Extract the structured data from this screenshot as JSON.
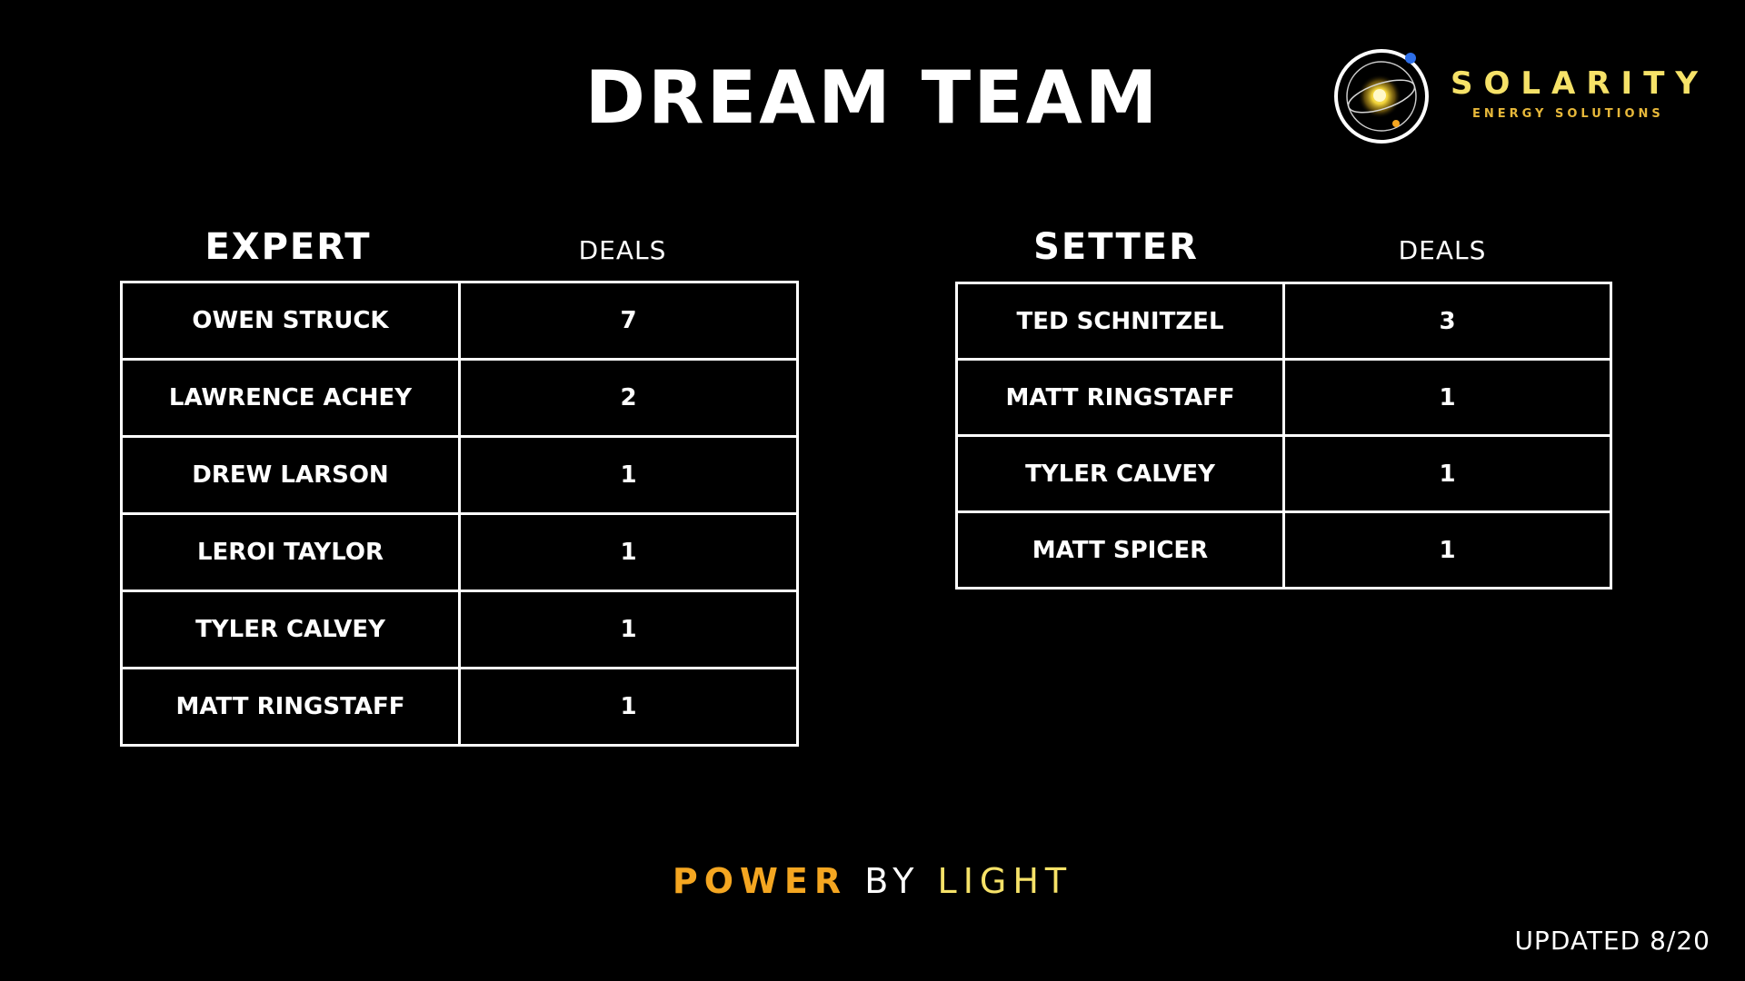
{
  "title": "DREAM TEAM",
  "logo": {
    "name": "SOLARITY",
    "subtitle": "ENERGY SOLUTIONS",
    "icon": "orbit-sun-icon"
  },
  "expert": {
    "header": "EXPERT",
    "deals_header": "DEALS",
    "rows": [
      {
        "name": "OWEN STRUCK",
        "deals": "7"
      },
      {
        "name": "LAWRENCE ACHEY",
        "deals": "2"
      },
      {
        "name": "DREW LARSON",
        "deals": "1"
      },
      {
        "name": "LEROI TAYLOR",
        "deals": "1"
      },
      {
        "name": "TYLER CALVEY",
        "deals": "1"
      },
      {
        "name": "MATT RINGSTAFF",
        "deals": "1"
      }
    ]
  },
  "setter": {
    "header": "SETTER",
    "deals_header": "DEALS",
    "rows": [
      {
        "name": "TED SCHNITZEL",
        "deals": "3"
      },
      {
        "name": "MATT RINGSTAFF",
        "deals": "1"
      },
      {
        "name": "TYLER CALVEY",
        "deals": "1"
      },
      {
        "name": "MATT SPICER",
        "deals": "1"
      }
    ]
  },
  "tagline": {
    "part1": "POWER",
    "part2": "BY",
    "part3": "LIGHT"
  },
  "updated": "UPDATED 8/20",
  "colors": {
    "background": "#000000",
    "text": "#ffffff",
    "brand_yellow": "#f6e268",
    "brand_orange": "#f4a621",
    "accent_blue": "#2e6fe8"
  }
}
